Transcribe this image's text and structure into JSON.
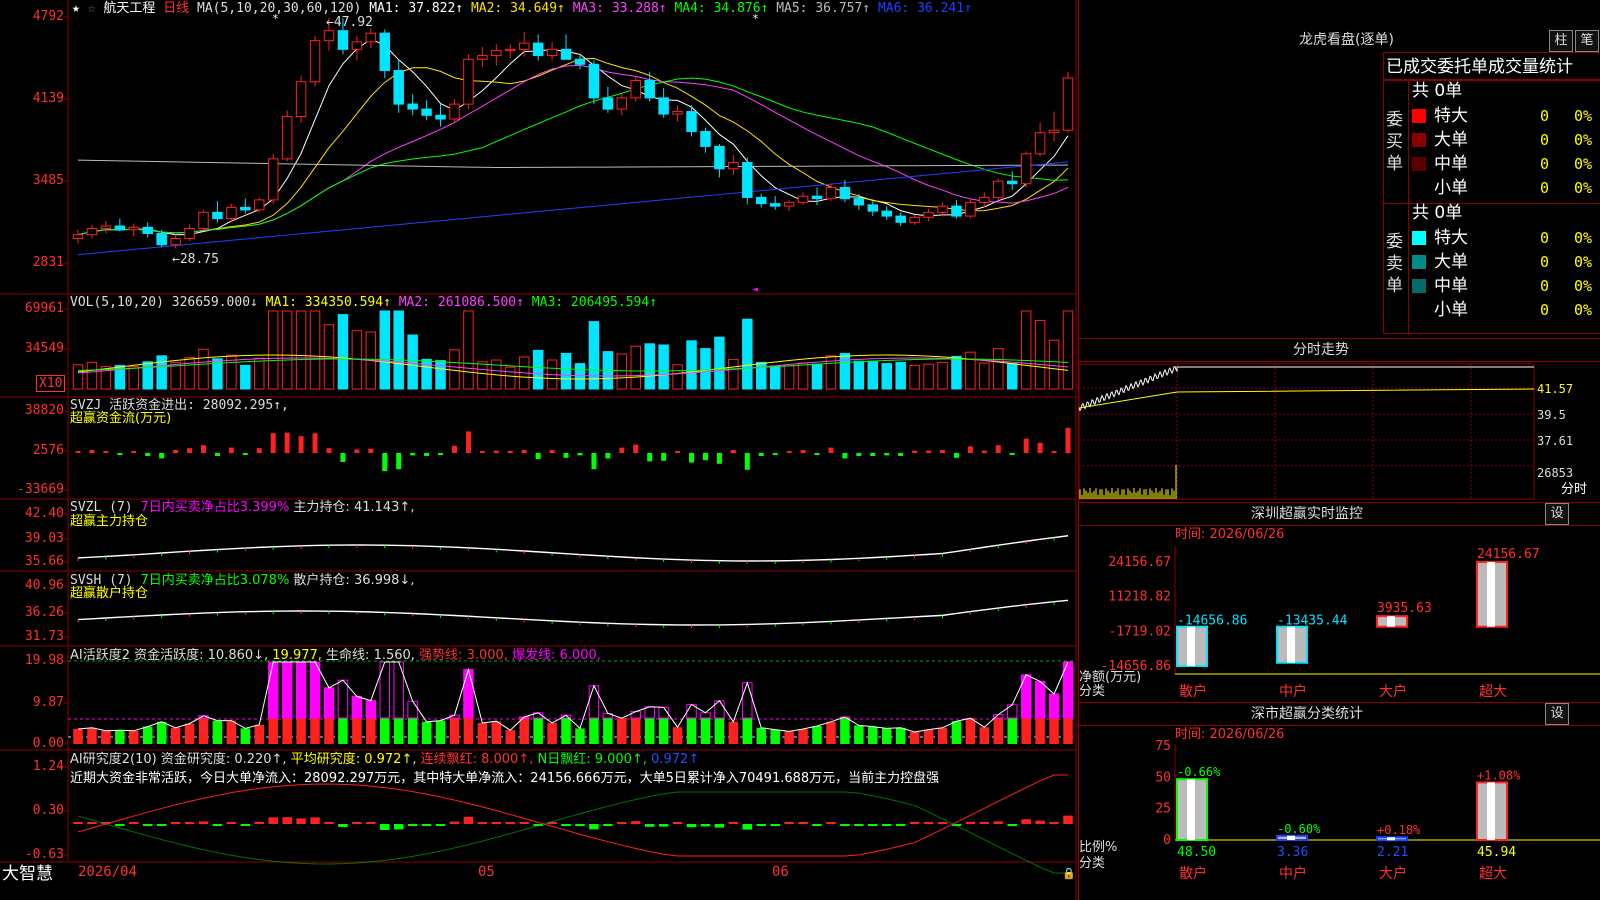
{
  "colors": {
    "up": "#ff2020",
    "down": "#00e5ff",
    "ma1": "#ffffff",
    "ma2": "#ffe000",
    "ma3": "#ff40ff",
    "ma4": "#00ff00",
    "ma5": "#bbbbbb",
    "ma6": "#2040ff",
    "green": "#00ff00",
    "magenta": "#ff00ff",
    "grid": "#8b0000"
  },
  "main": {
    "stock_name": "航天工程",
    "period": "日线",
    "ma_params": "MA(5,10,20,30,60,120)",
    "ma_values": [
      {
        "label": "MA1: 37.822↑",
        "color": "#ffffff"
      },
      {
        "label": "MA2: 34.649↑",
        "color": "#ffe000"
      },
      {
        "label": "MA3: 33.288↑",
        "color": "#ff40ff"
      },
      {
        "label": "MA4: 34.876↑",
        "color": "#00ff00"
      },
      {
        "label": "MA5: 36.757↑",
        "color": "#bbbbbb"
      },
      {
        "label": "MA6: 36.241↑",
        "color": "#2040ff"
      }
    ],
    "y_ticks": [
      "4792",
      "4139",
      "3485",
      "2831"
    ],
    "high_label": "47.92",
    "low_label": "28.75"
  },
  "vol": {
    "title": "VOL(5,10,20)",
    "value": "326659.000↓",
    "ma_values": [
      {
        "label": "MA1: 334350.594↑",
        "color": "#ffff00"
      },
      {
        "label": "MA2: 261086.500↑",
        "color": "#ff40ff"
      },
      {
        "label": "MA3: 206495.594↑",
        "color": "#00ff00"
      }
    ],
    "y_ticks": [
      "69961",
      "34549"
    ],
    "unit": "X10"
  },
  "svzj": {
    "title": "SVZJ  活跃资金进出: 28092.295↑,",
    "subtitle": "超赢资金流(万元)",
    "y_ticks": [
      "38820",
      "2576",
      "-33669"
    ]
  },
  "svzl": {
    "title": "SVZL (7) ",
    "title2": "7日内买卖净占比3.399%",
    "title3": " 主力持仓: 41.143↑,",
    "subtitle": "超赢主力持仓",
    "y_ticks": [
      "42.40",
      "39.03",
      "35.66"
    ]
  },
  "svsh": {
    "title": "SVSH (7) ",
    "title2": "7日内买卖净占比3.078%",
    "title3": " 散户持仓: 36.998↓,",
    "subtitle": "超赢散户持仓",
    "y_ticks": [
      "40.96",
      "36.26",
      "31.73"
    ]
  },
  "ai_act": {
    "title": "AI活跃度2 资金活跃度: 10.860↓,",
    "v2": " 19.977,",
    "v3": " 生命线: 1.560,",
    "v4": " 强势线: 3.000,",
    "v5": " 爆发线: 6.000,",
    "y_ticks": [
      "19.98",
      "9.87",
      "0.00"
    ]
  },
  "ai_res": {
    "title": "AI研究度2(10) 资金研究度: 0.220↑,",
    "v2": " 平均研究度: 0.972↑,",
    "v3": " 连续飘红: 8.000↑,",
    "v4": " N日飘红: 9.000↑,",
    "v5": " 0.972↑",
    "y_ticks": [
      "1.24",
      "0.30",
      "-0.63"
    ],
    "note": "近期大资金非常活跃，今日大单净流入：28092.297万元，其中特大单净流入：24156.666万元，大单5日累计净入70491.688万元，当前主力控盘强"
  },
  "x_axis": {
    "labels": [
      "2026/04",
      "05",
      "06"
    ],
    "brand": "大智慧"
  },
  "lhb": {
    "title": "龙虎看盘(逐单)",
    "btn1": "柱",
    "btn2": "笔",
    "header": "已成交委托单成交量统计",
    "buy_label": "委买单",
    "sell_label": "委卖单",
    "buy_total": "共 0单",
    "sell_total": "共 0单",
    "rows_buy": [
      {
        "name": "特大",
        "v": "0",
        "p": "0%",
        "c": "#ff0000"
      },
      {
        "name": "大单",
        "v": "0",
        "p": "0%",
        "c": "#8b0000"
      },
      {
        "name": "中单",
        "v": "0",
        "p": "0%",
        "c": "#5a0000"
      },
      {
        "name": "小单",
        "v": "0",
        "p": "0%",
        "c": ""
      }
    ],
    "rows_sell": [
      {
        "name": "特大",
        "v": "0",
        "p": "0%",
        "c": "#00ffff"
      },
      {
        "name": "大单",
        "v": "0",
        "p": "0%",
        "c": "#008b8b"
      },
      {
        "name": "中单",
        "v": "0",
        "p": "0%",
        "c": "#006b6b"
      },
      {
        "name": "小单",
        "v": "0",
        "p": "0%",
        "c": ""
      }
    ]
  },
  "intraday": {
    "title": "分时走势",
    "y_ticks": [
      "41.57",
      "39.5",
      "37.61",
      "26853"
    ],
    "footer": "分时"
  },
  "monitor": {
    "title": "深圳超赢实时监控",
    "btn": "设",
    "date": "时间: 2026/06/26",
    "y_ticks": [
      "24156.67",
      "11218.82",
      "-1719.02",
      "-14656.86"
    ],
    "axis_label1": "净额(万元)",
    "axis_label2": "分类",
    "bars": [
      {
        "name": "散户",
        "value": -14656.86,
        "label": "-14656.86"
      },
      {
        "name": "中户",
        "value": -13435.44,
        "label": "-13435.44"
      },
      {
        "name": "大户",
        "value": 3935.63,
        "label": "3935.63"
      },
      {
        "name": "超大",
        "value": 24156.67,
        "label": "24156.67"
      }
    ]
  },
  "classify": {
    "title": "深市超赢分类统计",
    "btn": "设",
    "date": "时间: 2026/06/26",
    "y_ticks": [
      "75",
      "50",
      "25",
      "0"
    ],
    "axis_label1": "比例%",
    "axis_label2": "分类",
    "bars": [
      {
        "name": "散户",
        "value": 48.5,
        "label": "48.50",
        "delta": "-0.66%"
      },
      {
        "name": "中户",
        "value": 3.36,
        "label": "3.36",
        "delta": "-0.60%"
      },
      {
        "name": "大户",
        "value": 2.21,
        "label": "2.21",
        "delta": "+0.18%"
      },
      {
        "name": "超大",
        "value": 45.94,
        "label": "45.94",
        "delta": "+1.08%"
      }
    ]
  },
  "chart_data": {
    "type": "bar",
    "title": "航天工程 日线",
    "candles": [
      [
        30.2,
        30.9,
        29.8,
        30.5
      ],
      [
        30.5,
        31.3,
        30.2,
        31.0
      ],
      [
        31.0,
        31.6,
        30.6,
        31.2
      ],
      [
        31.2,
        31.8,
        30.8,
        30.9
      ],
      [
        30.9,
        31.4,
        30.4,
        31.1
      ],
      [
        31.1,
        31.5,
        30.3,
        30.6
      ],
      [
        30.6,
        30.9,
        29.5,
        29.7
      ],
      [
        29.7,
        30.5,
        29.4,
        30.2
      ],
      [
        30.2,
        31.3,
        30.0,
        31.0
      ],
      [
        31.0,
        32.5,
        30.8,
        32.3
      ],
      [
        32.3,
        33.2,
        31.5,
        31.8
      ],
      [
        31.8,
        33.0,
        31.5,
        32.7
      ],
      [
        32.7,
        33.4,
        32.2,
        32.5
      ],
      [
        32.5,
        33.5,
        32.3,
        33.3
      ],
      [
        33.3,
        37.0,
        33.0,
        36.6
      ],
      [
        36.6,
        40.5,
        36.4,
        40.0
      ],
      [
        40.0,
        43.3,
        39.5,
        42.8
      ],
      [
        42.8,
        46.5,
        42.4,
        46.1
      ],
      [
        46.1,
        47.92,
        45.3,
        46.9
      ],
      [
        46.9,
        47.9,
        45.0,
        45.4
      ],
      [
        45.4,
        46.5,
        44.5,
        46.0
      ],
      [
        46.0,
        47.1,
        45.5,
        46.7
      ],
      [
        46.7,
        47.0,
        43.1,
        43.7
      ],
      [
        43.7,
        44.6,
        40.3,
        41.0
      ],
      [
        41.0,
        41.8,
        40.1,
        40.6
      ],
      [
        40.6,
        41.3,
        39.7,
        40.1
      ],
      [
        40.1,
        41.0,
        39.2,
        39.8
      ],
      [
        39.8,
        41.4,
        39.6,
        41.0
      ],
      [
        41.0,
        45.0,
        40.6,
        44.6
      ],
      [
        44.6,
        45.6,
        44.0,
        44.9
      ],
      [
        44.9,
        45.8,
        44.1,
        45.3
      ],
      [
        45.3,
        45.8,
        44.7,
        45.4
      ],
      [
        45.4,
        46.8,
        44.8,
        45.9
      ],
      [
        45.9,
        46.6,
        44.5,
        44.9
      ],
      [
        44.9,
        46.0,
        44.5,
        45.4
      ],
      [
        45.4,
        46.6,
        44.6,
        44.6
      ],
      [
        44.6,
        44.9,
        43.8,
        44.2
      ],
      [
        44.2,
        44.5,
        41.0,
        41.5
      ],
      [
        41.5,
        42.4,
        40.3,
        40.6
      ],
      [
        40.6,
        41.8,
        40.1,
        41.5
      ],
      [
        41.5,
        43.2,
        41.2,
        42.9
      ],
      [
        42.9,
        43.6,
        41.2,
        41.5
      ],
      [
        41.5,
        42.3,
        39.9,
        40.2
      ],
      [
        40.2,
        40.9,
        39.6,
        40.4
      ],
      [
        40.4,
        40.9,
        38.4,
        38.8
      ],
      [
        38.8,
        39.1,
        37.1,
        37.6
      ],
      [
        37.6,
        37.8,
        35.1,
        35.8
      ],
      [
        35.8,
        36.9,
        35.3,
        36.3
      ],
      [
        36.3,
        36.7,
        33.0,
        33.5
      ],
      [
        33.5,
        33.8,
        32.7,
        33.0
      ],
      [
        33.0,
        33.6,
        32.5,
        32.8
      ],
      [
        32.8,
        33.3,
        32.4,
        33.1
      ],
      [
        33.1,
        33.9,
        32.9,
        33.6
      ],
      [
        33.6,
        34.3,
        32.9,
        33.4
      ],
      [
        33.4,
        34.6,
        33.2,
        34.3
      ],
      [
        34.3,
        34.9,
        33.1,
        33.4
      ],
      [
        33.4,
        33.8,
        32.5,
        32.9
      ],
      [
        32.9,
        33.2,
        32.0,
        32.4
      ],
      [
        32.4,
        32.8,
        31.7,
        32.0
      ],
      [
        32.0,
        32.3,
        31.2,
        31.5
      ],
      [
        31.5,
        32.1,
        31.3,
        31.9
      ],
      [
        31.9,
        32.6,
        31.6,
        32.3
      ],
      [
        32.3,
        33.1,
        32.0,
        32.8
      ],
      [
        32.8,
        33.3,
        31.8,
        32.0
      ],
      [
        32.0,
        33.4,
        31.8,
        33.1
      ],
      [
        33.1,
        33.9,
        32.7,
        33.5
      ],
      [
        33.5,
        35.0,
        33.2,
        34.8
      ],
      [
        34.8,
        35.6,
        34.1,
        34.6
      ],
      [
        34.6,
        37.2,
        34.3,
        37.0
      ],
      [
        37.0,
        39.5,
        36.8,
        38.7
      ],
      [
        38.7,
        40.4,
        38.0,
        38.9
      ],
      [
        38.9,
        43.6,
        38.7,
        43.1
      ]
    ],
    "moving_averages": {
      "MA1": 37.822,
      "MA2": 34.649,
      "MA3": 33.288,
      "MA4": 34.876,
      "MA5": 36.757,
      "MA6": 36.241
    },
    "volume_ma": {
      "MA1": 334350.594,
      "MA2": 261086.5,
      "MA3": 206495.594
    },
    "ylim": [
      28.31,
      47.92
    ],
    "x_labels": [
      "2026/04",
      "05",
      "06"
    ]
  }
}
